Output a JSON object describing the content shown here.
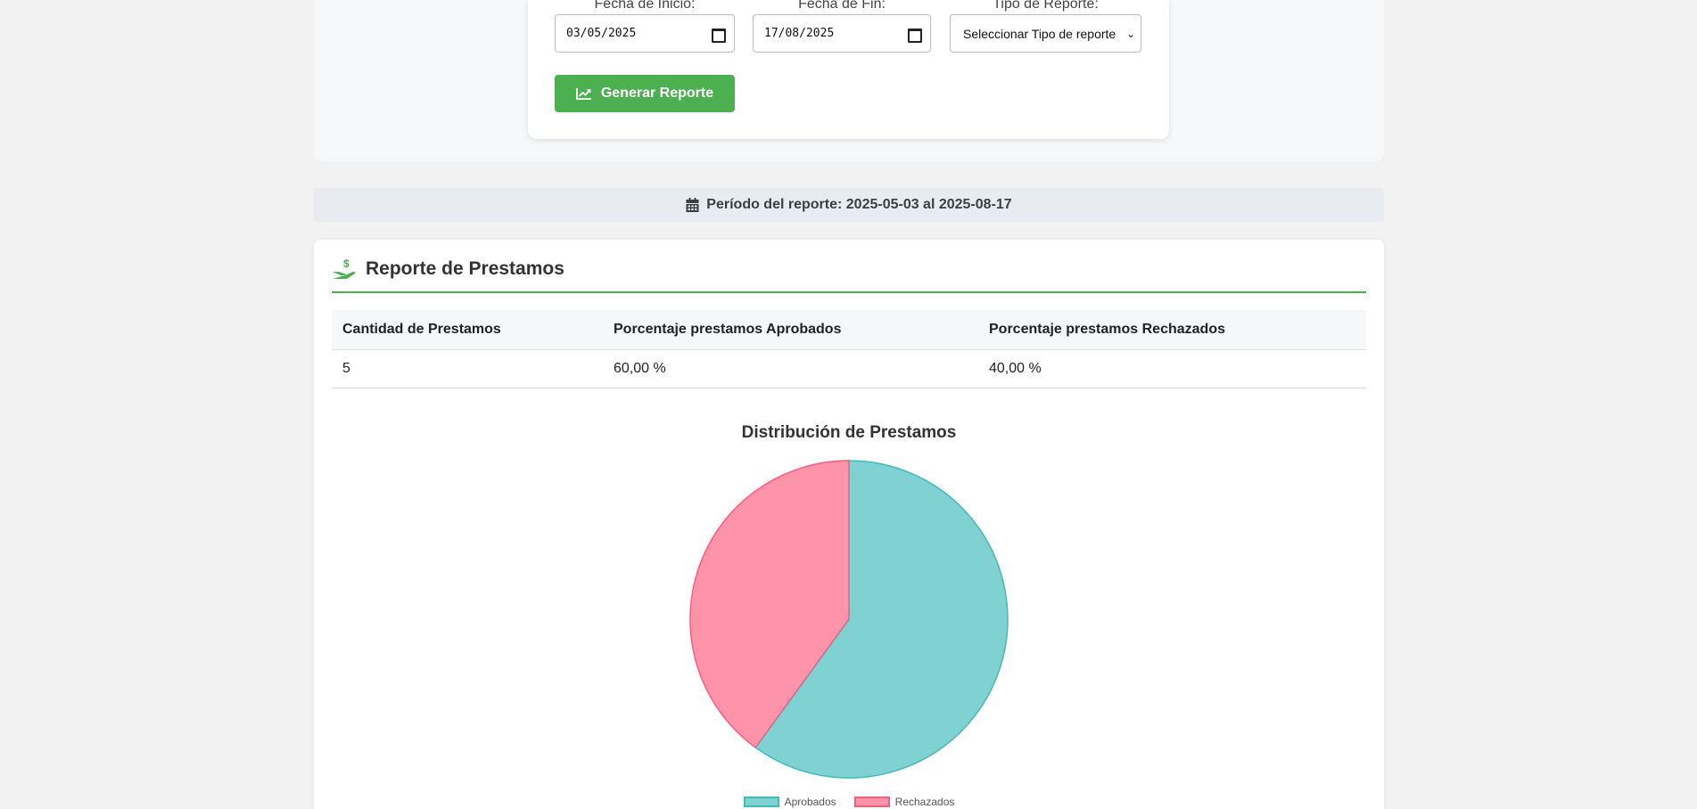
{
  "filters": {
    "start_label": "Fecha de Inicio:",
    "start_value": "03/05/2025",
    "end_label": "Fecha de Fin:",
    "end_value": "17/08/2025",
    "type_label": "Tipo de Reporte:",
    "type_value": "Seleccionar Tipo de reporte",
    "generate_button": "Generar Reporte"
  },
  "period": {
    "text": "Período del reporte: 2025-05-03 al 2025-08-17"
  },
  "report": {
    "title": "Reporte de Prestamos",
    "columns": [
      "Cantidad de Prestamos",
      "Porcentaje prestamos Aprobados",
      "Porcentaje prestamos Rechazados"
    ],
    "row": [
      "5",
      "60,00 %",
      "40,00 %"
    ]
  },
  "colors": {
    "accent": "#4caf50",
    "aprobados_fill": "#80d1d1",
    "aprobados_border": "#3dbcbc",
    "rechazados_fill": "#ff93a9",
    "rechazados_border": "#f0607e"
  },
  "chart_data": {
    "type": "pie",
    "title": "Distribución de Prestamos",
    "categories": [
      "Aprobados",
      "Rechazados"
    ],
    "values": [
      3,
      2
    ],
    "legend_position": "bottom"
  }
}
